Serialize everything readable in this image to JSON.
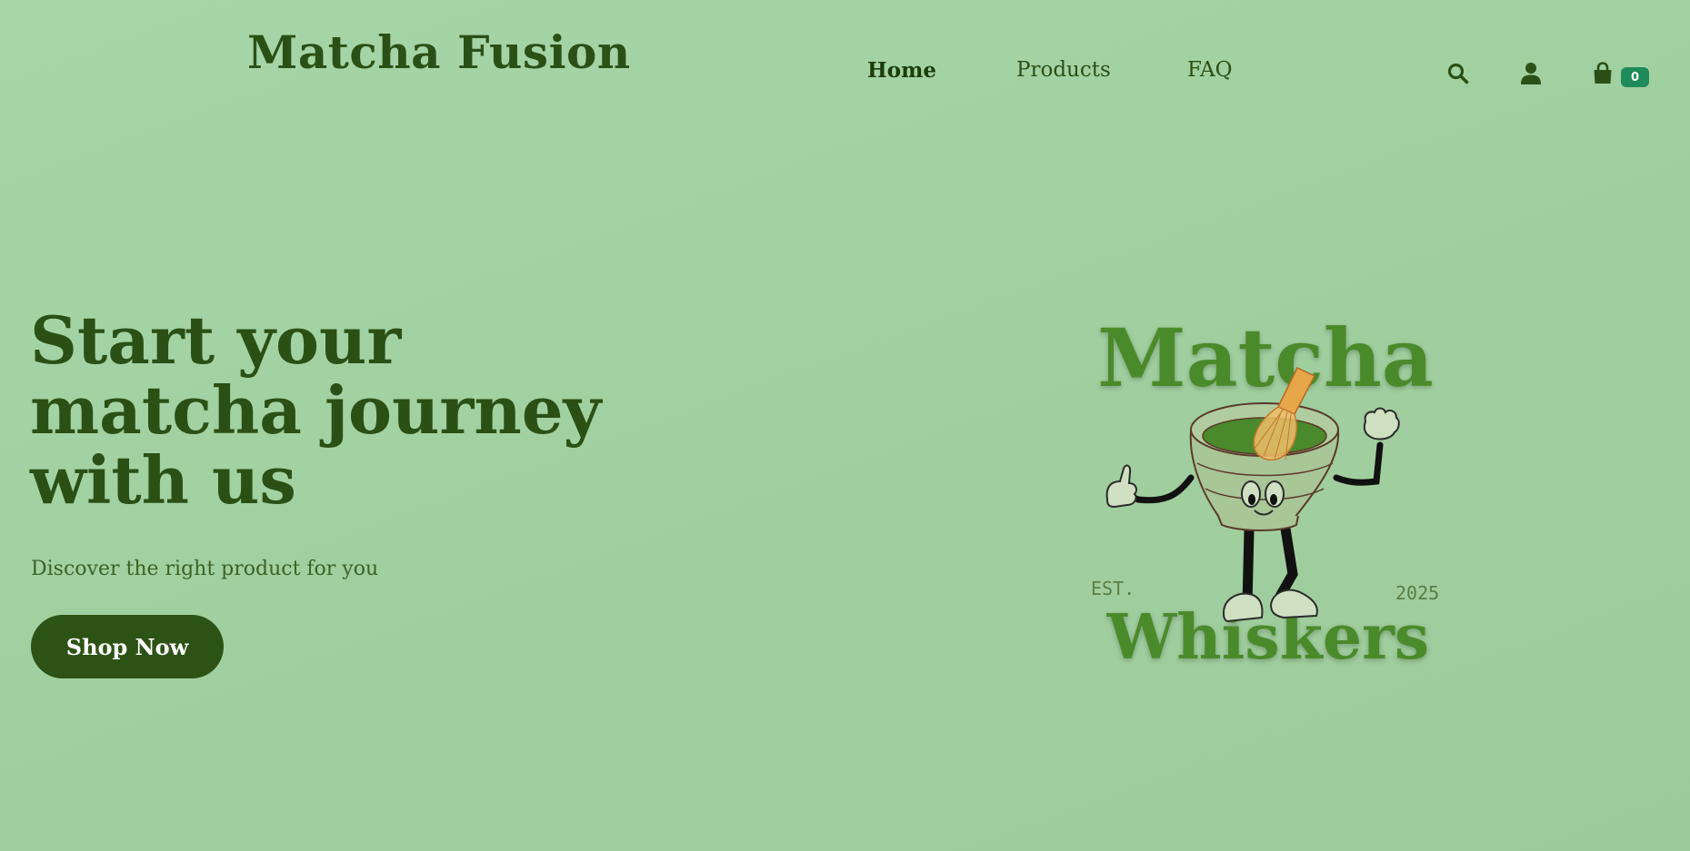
{
  "header": {
    "brand": "Matcha Fusion",
    "nav": [
      {
        "label": "Home",
        "active": true
      },
      {
        "label": "Products",
        "active": false
      },
      {
        "label": "FAQ",
        "active": false
      }
    ],
    "icons": [
      "search-icon",
      "user-icon",
      "shopping-bag-icon"
    ],
    "cart_count": "0"
  },
  "hero": {
    "title_lines": [
      "Start your",
      "matcha journey",
      "with us"
    ],
    "subtitle": "Discover the right product for you",
    "cta_label": "Shop Now"
  },
  "logo": {
    "top_text": "Matcha",
    "bottom_text": "Whiskers",
    "est_label": "EST.",
    "year": "2025"
  },
  "colors": {
    "background": "#a3d3a4",
    "text_dark_green": "#2b5015",
    "button_bg": "#2d5215",
    "badge_bg": "#1f8a5a",
    "logo_green": "#4c8a2b",
    "whisk_orange": "#e7a64a"
  }
}
